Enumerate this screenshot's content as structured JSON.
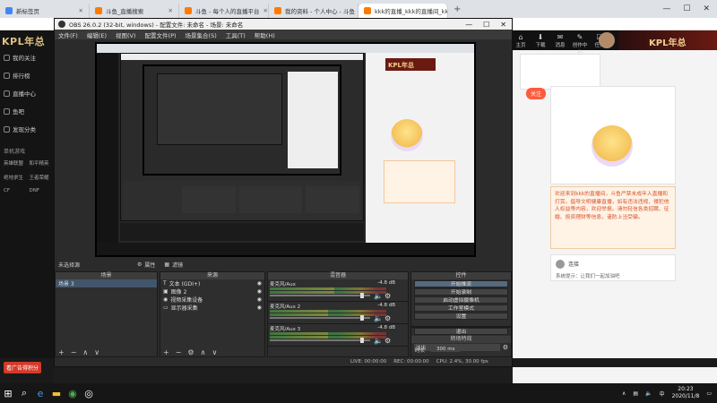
{
  "browser": {
    "tabs": [
      {
        "label": "新标签页",
        "color": "#4285f4"
      },
      {
        "label": "斗鱼_直播搜索",
        "color": "#ff7a00"
      },
      {
        "label": "斗鱼 - 每个人的直播平台",
        "color": "#ff7a00"
      },
      {
        "label": "我的资料 - 个人中心 - 斗鱼",
        "color": "#ff7a00"
      },
      {
        "label": "kkk的直播_kkk的直播间_kkk的...",
        "color": "#ff7a00"
      }
    ],
    "window_controls": [
      "—",
      "☐",
      "✕"
    ]
  },
  "obs": {
    "title": "OBS 26.0.2 (32-bit, windows) - 配置文件: 未命名 - 场景: 未命名",
    "menu": [
      "文件(F)",
      "编辑(E)",
      "视图(V)",
      "配置文件(P)",
      "场景集合(S)",
      "工具(T)",
      "帮助(H)"
    ],
    "source_status": "未选择源",
    "source_props": "属性",
    "source_filters": "滤镜",
    "scenes_header": "场景",
    "scenes": [
      "场景 3"
    ],
    "sources_header": "来源",
    "sources": [
      {
        "icon": "T",
        "label": "文本 (GDI+)"
      },
      {
        "icon": "▣",
        "label": "图像 2"
      },
      {
        "icon": "◉",
        "label": "视频采集设备"
      },
      {
        "icon": "▭",
        "label": "显示器采集"
      }
    ],
    "mixer_header": "混音器",
    "mixer": [
      {
        "name": "麦克风/Aux",
        "db": "-4.8 dB",
        "level": 0.55,
        "volume": 0.92
      },
      {
        "name": "麦克风/Aux 2",
        "db": "-4.8 dB",
        "level": 0.5,
        "volume": 0.92
      },
      {
        "name": "麦克风/Aux 3",
        "db": "-4.8 dB",
        "level": 0.5,
        "volume": 0.92
      }
    ],
    "controls_header": "控件",
    "controls": [
      "开始推流",
      "开始录制",
      "启动虚拟摄像机",
      "工作室模式",
      "设置",
      "退出"
    ],
    "transitions_header": "转场特效",
    "transition_type": "淡出",
    "duration_label": "时长",
    "duration_value": "300 ms",
    "status": {
      "live": "LIVE: 00:00:00",
      "rec": "REC: 00:00:00",
      "cpu": "CPU: 2.4%, 30.00 fps"
    }
  },
  "left_site": {
    "logo": "KPL年总",
    "nav": [
      "我的关注",
      "排行榜",
      "直播中心",
      "鱼吧",
      "发现分类"
    ],
    "section": "单机游戏",
    "games": [
      "英雄联盟",
      "和平精英",
      "绝地求生",
      "王者荣耀",
      "CF",
      "DNF"
    ],
    "button": "看广告得积分"
  },
  "right_site": {
    "logo": "KPL年总",
    "top_icons": [
      "主页",
      "下载",
      "消息",
      "创作中心",
      "任务"
    ],
    "follow": "关注",
    "info_text": "欢迎来到kkk的直播间，斗鱼严禁未成年人直播和打赏。倡导文明健康直播，如有违法违规、侵犯他人权益等内容，欢迎举报。请勿轻信各类招聘、征婚、投资理财等信息，谨防上当受骗。",
    "user_line": "连接",
    "user_sub": "系统提示：让我们一起加油吧"
  },
  "taskbar": {
    "time": "20:23",
    "date": "2020/11/8",
    "lang": "中"
  }
}
